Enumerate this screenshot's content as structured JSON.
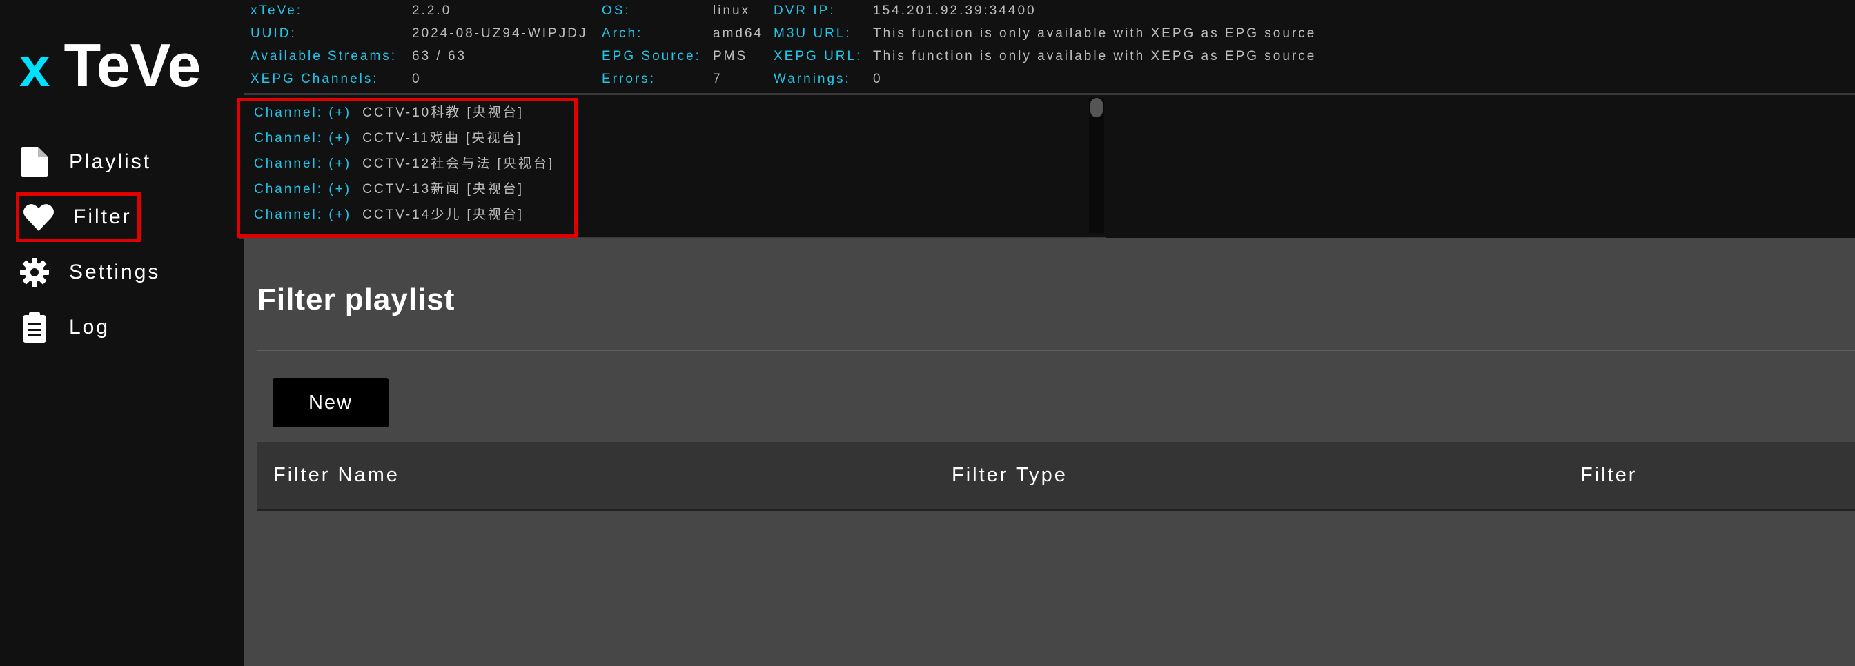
{
  "app": {
    "logo_x": "x",
    "logo_teve": "TeVe"
  },
  "sidebar": {
    "items": [
      {
        "label": "Playlist",
        "icon": "file-icon"
      },
      {
        "label": "Filter",
        "icon": "heart-icon",
        "active": true
      },
      {
        "label": "Settings",
        "icon": "gear-icon"
      },
      {
        "label": "Log",
        "icon": "clipboard-icon"
      }
    ]
  },
  "status": {
    "xteve_label": "xTeVe:",
    "xteve_value": "2.2.0",
    "uuid_label": "UUID:",
    "uuid_value": "2024-08-UZ94-WIPJDJ",
    "streams_label": "Available Streams:",
    "streams_value": "63 / 63",
    "channels_label": "XEPG Channels:",
    "channels_value": "0",
    "os_label": "OS:",
    "os_value": "linux",
    "arch_label": "Arch:",
    "arch_value": "amd64",
    "epg_label": "EPG Source:",
    "epg_value": "PMS",
    "errors_label": "Errors:",
    "errors_value": "7",
    "dvr_label": "DVR IP:",
    "dvr_value": "154.201.92.39:34400",
    "m3u_label": "M3U URL:",
    "m3u_value": "This function is only available with XEPG as EPG source",
    "xepg_label": "XEPG URL:",
    "xepg_value": "This function is only available with XEPG as EPG source",
    "warnings_label": "Warnings:",
    "warnings_value": "0"
  },
  "log": {
    "lines": [
      {
        "key": "Channel: (+)",
        "value": "CCTV-10科教 [央视台]"
      },
      {
        "key": "Channel: (+)",
        "value": "CCTV-11戏曲 [央视台]"
      },
      {
        "key": "Channel: (+)",
        "value": "CCTV-12社会与法 [央视台]"
      },
      {
        "key": "Channel: (+)",
        "value": "CCTV-13新闻 [央视台]"
      },
      {
        "key": "Channel: (+)",
        "value": "CCTV-14少儿 [央视台]"
      }
    ]
  },
  "main": {
    "title": "Filter playlist",
    "new_button": "New",
    "columns": [
      "Filter Name",
      "Filter Type",
      "Filter"
    ]
  },
  "colors": {
    "accent": "#21c5e8",
    "logo_x": "#00e1ff",
    "highlight": "#e00000",
    "panel": "#474747",
    "background": "#111111"
  }
}
